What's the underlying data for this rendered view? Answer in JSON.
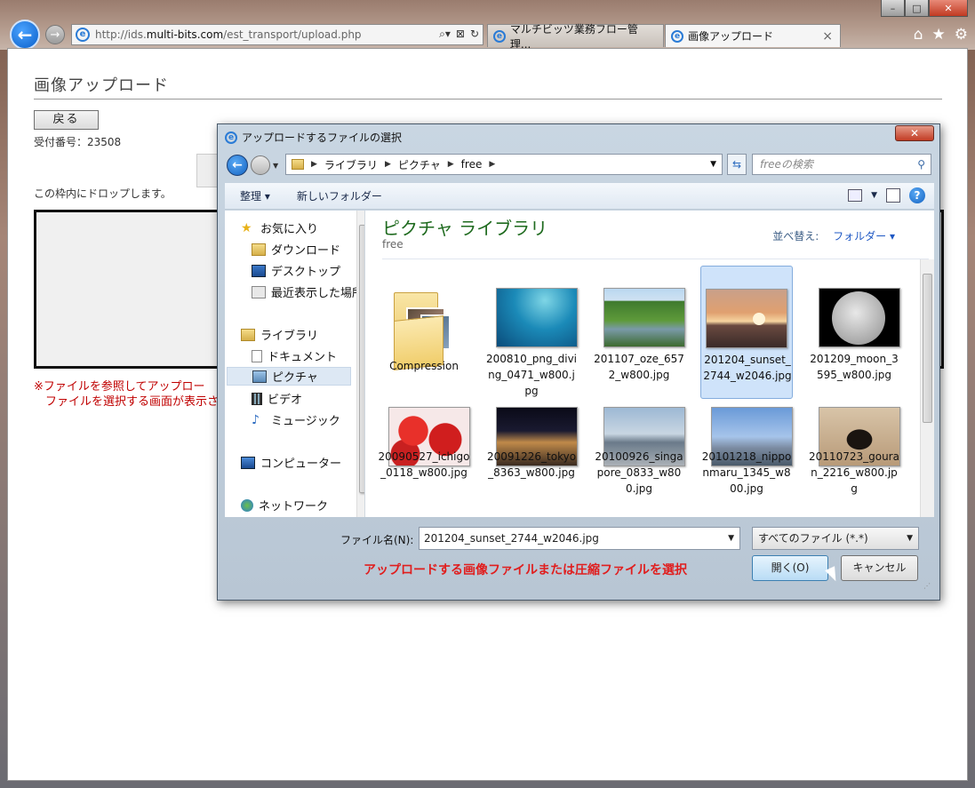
{
  "browser": {
    "url_prefix": "http://ids.",
    "url_host": "multi-bits.com",
    "url_path": "/est_transport/upload.php",
    "tabs": [
      {
        "label": "マルチビッツ業務フロー管理..."
      },
      {
        "label": "画像アップロード"
      }
    ],
    "tab_close": "×"
  },
  "page": {
    "title": "画像アップロード",
    "back_button": "戻る",
    "receipt": "受付番号：23508",
    "drop_instruction": "この枠内にドロップします。",
    "note_line1": "※ファイルを参照してアップロー",
    "note_line2": "ファイルを選択する画面が表示さ"
  },
  "dialog": {
    "title": "アップロードするファイルの選択",
    "path": [
      "ライブラリ",
      "ピクチャ",
      "free"
    ],
    "search_placeholder": "freeの検索",
    "toolbar": {
      "organize": "整理 ▾",
      "new_folder": "新しいフォルダー"
    },
    "nav_items": [
      {
        "label": "お気に入り",
        "icon": "star-icon"
      },
      {
        "label": "ダウンロード",
        "icon": "download-folder-icon"
      },
      {
        "label": "デスクトップ",
        "icon": "desktop-icon"
      },
      {
        "label": "最近表示した場所",
        "icon": "recent-places-icon"
      },
      {
        "label": "ライブラリ",
        "icon": "library-icon"
      },
      {
        "label": "ドキュメント",
        "icon": "documents-icon"
      },
      {
        "label": "ピクチャ",
        "icon": "pictures-icon"
      },
      {
        "label": "ビデオ",
        "icon": "video-icon"
      },
      {
        "label": "ミュージック",
        "icon": "music-icon"
      },
      {
        "label": "コンピューター",
        "icon": "computer-icon"
      },
      {
        "label": "ネットワーク",
        "icon": "network-icon"
      }
    ],
    "library_title": "ピクチャ ライブラリ",
    "library_subtitle": "free",
    "sort_label": "並べ替え:",
    "sort_value": "フォルダー ▾",
    "files": [
      {
        "name": "Compression"
      },
      {
        "name": "200810_png_diving_0471_w800.jpg"
      },
      {
        "name": "201107_oze_6572_w800.jpg"
      },
      {
        "name": "201204_sunset_2744_w2046.jpg"
      },
      {
        "name": "201209_moon_3595_w800.jpg"
      },
      {
        "name": "20090527_ichigo_0118_w800.jpg"
      },
      {
        "name": "20091226_tokyo_8363_w800.jpg"
      },
      {
        "name": "20100926_singapore_0833_w800.jpg"
      },
      {
        "name": "20101218_nipponmaru_1345_w800.jpg"
      },
      {
        "name": "20110723_gouran_2216_w800.jpg"
      }
    ],
    "filename_label": "ファイル名(N):",
    "filename_value": "201204_sunset_2744_w2046.jpg",
    "filter_value": "すべてのファイル (*.*)",
    "hint": "アップロードする画像ファイルまたは圧縮ファイルを選択",
    "open_button": "開く(O)",
    "cancel_button": "キャンセル"
  }
}
